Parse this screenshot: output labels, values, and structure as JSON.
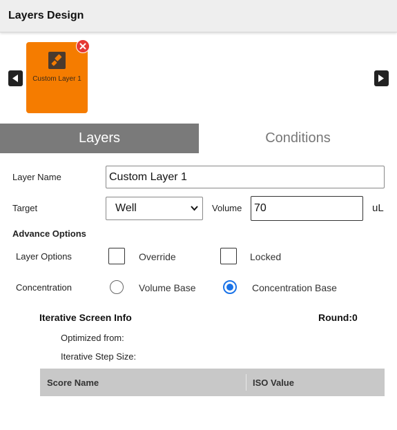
{
  "header": {
    "title": "Layers Design"
  },
  "layers": [
    {
      "label": "Custom Layer 1",
      "icon": "paintbrush-icon",
      "color": "#f57c00"
    }
  ],
  "tabs": [
    {
      "label": "Layers",
      "active": true
    },
    {
      "label": "Conditions",
      "active": false
    }
  ],
  "form": {
    "layer_name_label": "Layer Name",
    "layer_name_value": "Custom Layer 1",
    "target_label": "Target",
    "target_value": "Well",
    "volume_label": "Volume",
    "volume_value": "70",
    "volume_unit": "uL",
    "advance_options_title": "Advance Options",
    "layer_options_label": "Layer Options",
    "override_label": "Override",
    "locked_label": "Locked",
    "concentration_label": "Concentration",
    "volume_base_label": "Volume Base",
    "concentration_base_label": "Concentration Base",
    "selected_concentration": "Concentration Base"
  },
  "iterative": {
    "title": "Iterative Screen Info",
    "round": "Round:0",
    "optimized_from": "Optimized from:",
    "step_size": "Iterative Step Size:",
    "columns": [
      "Score Name",
      "ISO Value"
    ]
  },
  "colors": {
    "accent": "#f57c00",
    "tab_active": "#7a7a7a",
    "radio": "#1a73e8",
    "remove": "#e53935"
  }
}
